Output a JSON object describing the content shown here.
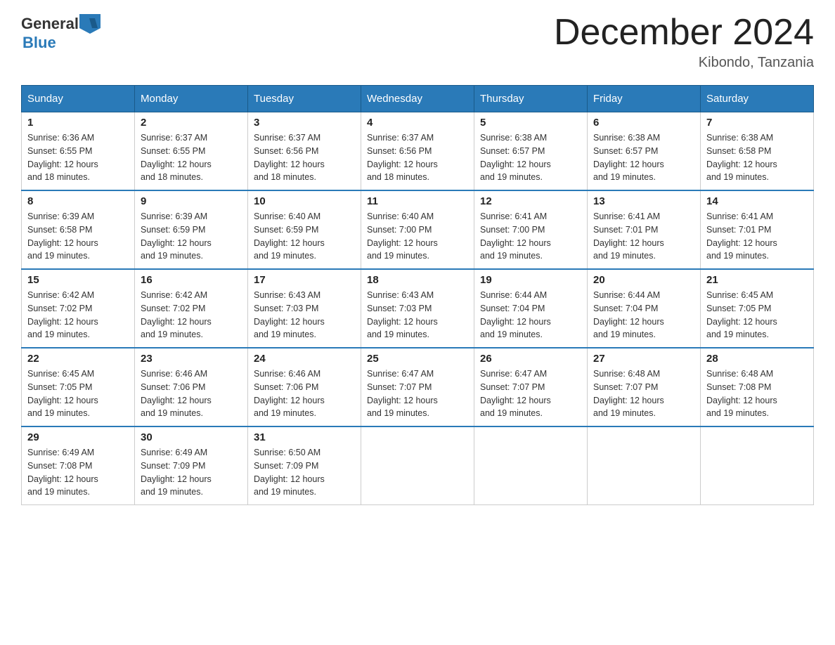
{
  "header": {
    "logo": {
      "general": "General",
      "blue": "Blue",
      "icon_alt": "GeneralBlue logo"
    },
    "title": "December 2024",
    "location": "Kibondo, Tanzania"
  },
  "weekdays": [
    "Sunday",
    "Monday",
    "Tuesday",
    "Wednesday",
    "Thursday",
    "Friday",
    "Saturday"
  ],
  "weeks": [
    [
      {
        "day": "1",
        "sunrise": "Sunrise: 6:36 AM",
        "sunset": "Sunset: 6:55 PM",
        "daylight": "Daylight: 12 hours",
        "daylight2": "and 18 minutes."
      },
      {
        "day": "2",
        "sunrise": "Sunrise: 6:37 AM",
        "sunset": "Sunset: 6:55 PM",
        "daylight": "Daylight: 12 hours",
        "daylight2": "and 18 minutes."
      },
      {
        "day": "3",
        "sunrise": "Sunrise: 6:37 AM",
        "sunset": "Sunset: 6:56 PM",
        "daylight": "Daylight: 12 hours",
        "daylight2": "and 18 minutes."
      },
      {
        "day": "4",
        "sunrise": "Sunrise: 6:37 AM",
        "sunset": "Sunset: 6:56 PM",
        "daylight": "Daylight: 12 hours",
        "daylight2": "and 18 minutes."
      },
      {
        "day": "5",
        "sunrise": "Sunrise: 6:38 AM",
        "sunset": "Sunset: 6:57 PM",
        "daylight": "Daylight: 12 hours",
        "daylight2": "and 19 minutes."
      },
      {
        "day": "6",
        "sunrise": "Sunrise: 6:38 AM",
        "sunset": "Sunset: 6:57 PM",
        "daylight": "Daylight: 12 hours",
        "daylight2": "and 19 minutes."
      },
      {
        "day": "7",
        "sunrise": "Sunrise: 6:38 AM",
        "sunset": "Sunset: 6:58 PM",
        "daylight": "Daylight: 12 hours",
        "daylight2": "and 19 minutes."
      }
    ],
    [
      {
        "day": "8",
        "sunrise": "Sunrise: 6:39 AM",
        "sunset": "Sunset: 6:58 PM",
        "daylight": "Daylight: 12 hours",
        "daylight2": "and 19 minutes."
      },
      {
        "day": "9",
        "sunrise": "Sunrise: 6:39 AM",
        "sunset": "Sunset: 6:59 PM",
        "daylight": "Daylight: 12 hours",
        "daylight2": "and 19 minutes."
      },
      {
        "day": "10",
        "sunrise": "Sunrise: 6:40 AM",
        "sunset": "Sunset: 6:59 PM",
        "daylight": "Daylight: 12 hours",
        "daylight2": "and 19 minutes."
      },
      {
        "day": "11",
        "sunrise": "Sunrise: 6:40 AM",
        "sunset": "Sunset: 7:00 PM",
        "daylight": "Daylight: 12 hours",
        "daylight2": "and 19 minutes."
      },
      {
        "day": "12",
        "sunrise": "Sunrise: 6:41 AM",
        "sunset": "Sunset: 7:00 PM",
        "daylight": "Daylight: 12 hours",
        "daylight2": "and 19 minutes."
      },
      {
        "day": "13",
        "sunrise": "Sunrise: 6:41 AM",
        "sunset": "Sunset: 7:01 PM",
        "daylight": "Daylight: 12 hours",
        "daylight2": "and 19 minutes."
      },
      {
        "day": "14",
        "sunrise": "Sunrise: 6:41 AM",
        "sunset": "Sunset: 7:01 PM",
        "daylight": "Daylight: 12 hours",
        "daylight2": "and 19 minutes."
      }
    ],
    [
      {
        "day": "15",
        "sunrise": "Sunrise: 6:42 AM",
        "sunset": "Sunset: 7:02 PM",
        "daylight": "Daylight: 12 hours",
        "daylight2": "and 19 minutes."
      },
      {
        "day": "16",
        "sunrise": "Sunrise: 6:42 AM",
        "sunset": "Sunset: 7:02 PM",
        "daylight": "Daylight: 12 hours",
        "daylight2": "and 19 minutes."
      },
      {
        "day": "17",
        "sunrise": "Sunrise: 6:43 AM",
        "sunset": "Sunset: 7:03 PM",
        "daylight": "Daylight: 12 hours",
        "daylight2": "and 19 minutes."
      },
      {
        "day": "18",
        "sunrise": "Sunrise: 6:43 AM",
        "sunset": "Sunset: 7:03 PM",
        "daylight": "Daylight: 12 hours",
        "daylight2": "and 19 minutes."
      },
      {
        "day": "19",
        "sunrise": "Sunrise: 6:44 AM",
        "sunset": "Sunset: 7:04 PM",
        "daylight": "Daylight: 12 hours",
        "daylight2": "and 19 minutes."
      },
      {
        "day": "20",
        "sunrise": "Sunrise: 6:44 AM",
        "sunset": "Sunset: 7:04 PM",
        "daylight": "Daylight: 12 hours",
        "daylight2": "and 19 minutes."
      },
      {
        "day": "21",
        "sunrise": "Sunrise: 6:45 AM",
        "sunset": "Sunset: 7:05 PM",
        "daylight": "Daylight: 12 hours",
        "daylight2": "and 19 minutes."
      }
    ],
    [
      {
        "day": "22",
        "sunrise": "Sunrise: 6:45 AM",
        "sunset": "Sunset: 7:05 PM",
        "daylight": "Daylight: 12 hours",
        "daylight2": "and 19 minutes."
      },
      {
        "day": "23",
        "sunrise": "Sunrise: 6:46 AM",
        "sunset": "Sunset: 7:06 PM",
        "daylight": "Daylight: 12 hours",
        "daylight2": "and 19 minutes."
      },
      {
        "day": "24",
        "sunrise": "Sunrise: 6:46 AM",
        "sunset": "Sunset: 7:06 PM",
        "daylight": "Daylight: 12 hours",
        "daylight2": "and 19 minutes."
      },
      {
        "day": "25",
        "sunrise": "Sunrise: 6:47 AM",
        "sunset": "Sunset: 7:07 PM",
        "daylight": "Daylight: 12 hours",
        "daylight2": "and 19 minutes."
      },
      {
        "day": "26",
        "sunrise": "Sunrise: 6:47 AM",
        "sunset": "Sunset: 7:07 PM",
        "daylight": "Daylight: 12 hours",
        "daylight2": "and 19 minutes."
      },
      {
        "day": "27",
        "sunrise": "Sunrise: 6:48 AM",
        "sunset": "Sunset: 7:07 PM",
        "daylight": "Daylight: 12 hours",
        "daylight2": "and 19 minutes."
      },
      {
        "day": "28",
        "sunrise": "Sunrise: 6:48 AM",
        "sunset": "Sunset: 7:08 PM",
        "daylight": "Daylight: 12 hours",
        "daylight2": "and 19 minutes."
      }
    ],
    [
      {
        "day": "29",
        "sunrise": "Sunrise: 6:49 AM",
        "sunset": "Sunset: 7:08 PM",
        "daylight": "Daylight: 12 hours",
        "daylight2": "and 19 minutes."
      },
      {
        "day": "30",
        "sunrise": "Sunrise: 6:49 AM",
        "sunset": "Sunset: 7:09 PM",
        "daylight": "Daylight: 12 hours",
        "daylight2": "and 19 minutes."
      },
      {
        "day": "31",
        "sunrise": "Sunrise: 6:50 AM",
        "sunset": "Sunset: 7:09 PM",
        "daylight": "Daylight: 12 hours",
        "daylight2": "and 19 minutes."
      },
      null,
      null,
      null,
      null
    ]
  ]
}
